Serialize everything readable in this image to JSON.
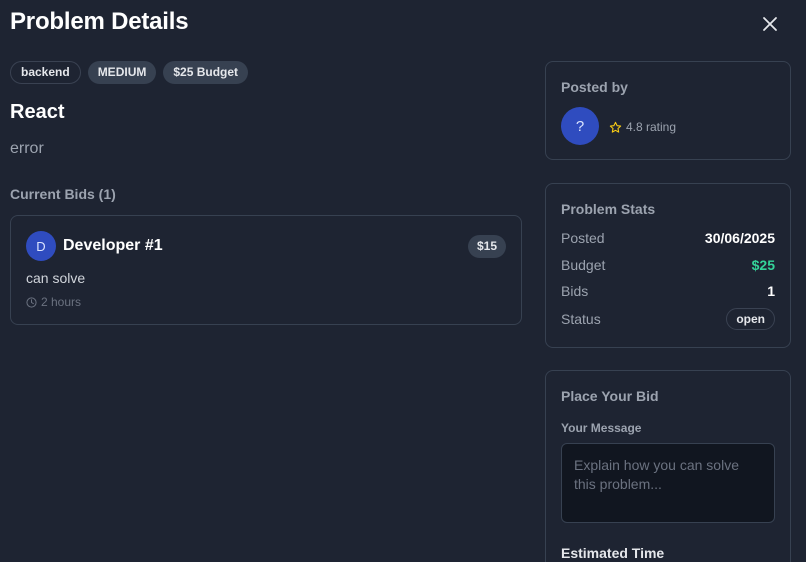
{
  "modal": {
    "title": "Problem Details",
    "close_icon": "close-icon"
  },
  "tags": {
    "category": "backend",
    "difficulty": "MEDIUM",
    "budget": "$25 Budget"
  },
  "problem": {
    "title": "React",
    "description": "error"
  },
  "bids": {
    "heading": "Current Bids (1)",
    "items": [
      {
        "avatar_letter": "D",
        "name": "Developer #1",
        "amount": "$15",
        "message": "can solve",
        "time": "2 hours",
        "time_icon": "clock-icon"
      }
    ]
  },
  "posted_by": {
    "heading": "Posted by",
    "avatar": "?",
    "rating_icon": "star-icon",
    "rating": "4.8 rating"
  },
  "stats": {
    "heading": "Problem Stats",
    "posted_label": "Posted",
    "posted_value": "30/06/2025",
    "budget_label": "Budget",
    "budget_value": "$25",
    "bids_label": "Bids",
    "bids_value": "1",
    "status_label": "Status",
    "status_value": "open"
  },
  "place_bid": {
    "heading": "Place Your Bid",
    "message_label": "Your Message",
    "message_placeholder": "Explain how you can solve this problem...",
    "message_value": "",
    "estimated_time_label": "Estimated Time"
  },
  "colors": {
    "background": "#1e2432",
    "card_border": "#374151",
    "avatar_blue": "#2f4cbf",
    "budget_green": "#34d399",
    "star_yellow": "#facc15"
  }
}
